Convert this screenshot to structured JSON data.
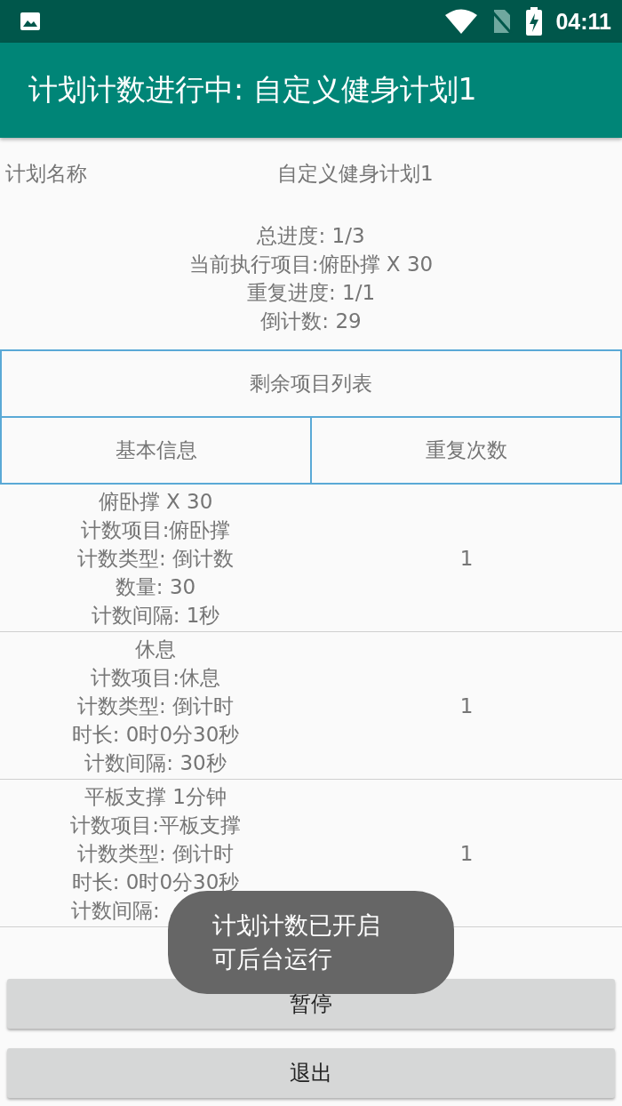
{
  "status_bar": {
    "time": "04:11"
  },
  "app_bar": {
    "title": "计划计数进行中: 自定义健身计划1"
  },
  "plan": {
    "label": "计划名称",
    "value": "自定义健身计划1"
  },
  "progress": [
    "总进度: 1/3",
    "当前执行项目:俯卧撑 X 30",
    "重复进度: 1/1",
    "倒计数: 29"
  ],
  "list_title": "剩余项目列表",
  "table": {
    "columns": [
      "基本信息",
      "重复次数"
    ],
    "rows": [
      {
        "info": [
          "俯卧撑 X 30",
          "计数项目:俯卧撑",
          "计数类型: 倒计数",
          "数量: 30",
          "计数间隔: 1秒"
        ],
        "repeat": "1"
      },
      {
        "info": [
          "休息",
          "计数项目:休息",
          "计数类型: 倒计时",
          "时长: 0时0分30秒",
          "计数间隔: 30秒"
        ],
        "repeat": "1"
      },
      {
        "info": [
          "平板支撑 1分钟",
          "计数项目:平板支撑",
          "计数类型: 倒计时",
          "时长: 0时0分30秒",
          "计数间隔:"
        ],
        "repeat": "1"
      }
    ]
  },
  "buttons": [
    "暂停",
    "退出"
  ],
  "toast": [
    "计划计数已开启",
    "可后台运行"
  ]
}
